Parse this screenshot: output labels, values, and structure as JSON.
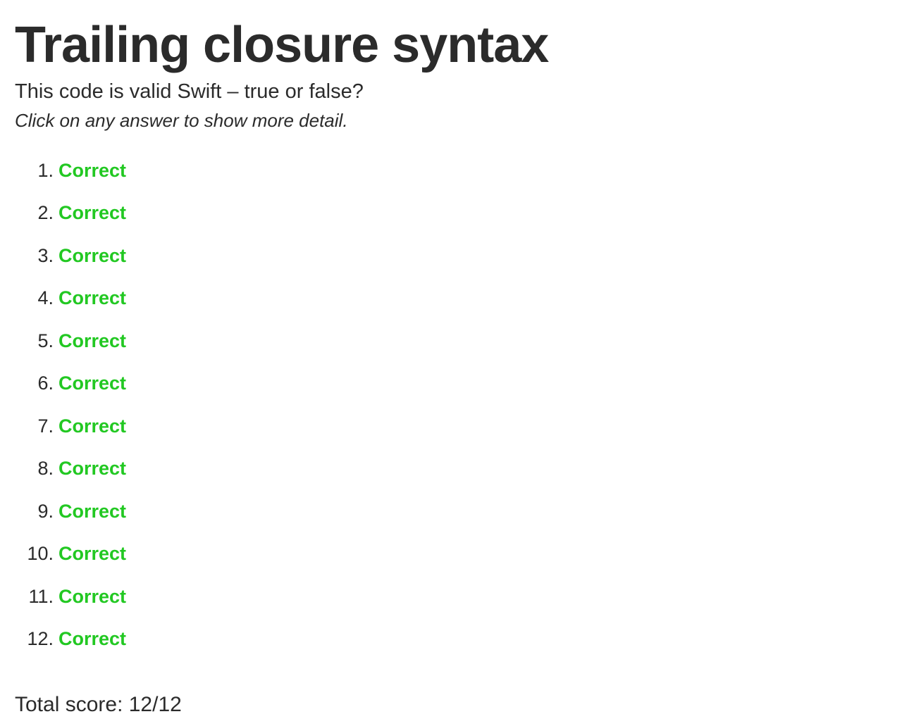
{
  "title": "Trailing closure syntax",
  "question": "This code is valid Swift – true or false?",
  "hint": "Click on any answer to show more detail.",
  "answers": [
    {
      "number": "1.",
      "status": "Correct"
    },
    {
      "number": "2.",
      "status": "Correct"
    },
    {
      "number": "3.",
      "status": "Correct"
    },
    {
      "number": "4.",
      "status": "Correct"
    },
    {
      "number": "5.",
      "status": "Correct"
    },
    {
      "number": "6.",
      "status": "Correct"
    },
    {
      "number": "7.",
      "status": "Correct"
    },
    {
      "number": "8.",
      "status": "Correct"
    },
    {
      "number": "9.",
      "status": "Correct"
    },
    {
      "number": "10.",
      "status": "Correct"
    },
    {
      "number": "11.",
      "status": "Correct"
    },
    {
      "number": "12.",
      "status": "Correct"
    }
  ],
  "total_score": "Total score: 12/12",
  "colors": {
    "correct": "#22c822",
    "text": "#2b2b2b"
  }
}
